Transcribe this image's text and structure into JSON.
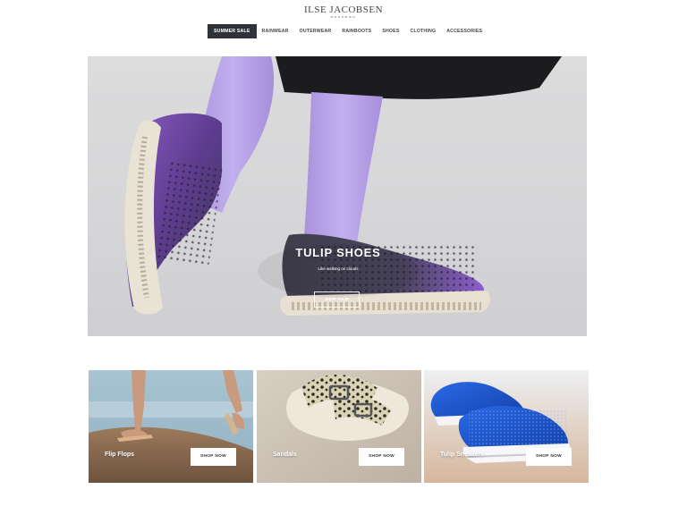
{
  "header": {
    "logo": "ILSE JACOBSEN",
    "logo_sub": "HORNBÆK"
  },
  "nav": {
    "items": [
      {
        "label": "SUMMER SALE",
        "active": true
      },
      {
        "label": "RAINWEAR"
      },
      {
        "label": "OUTERWEAR"
      },
      {
        "label": "RAINBOOTS"
      },
      {
        "label": "SHOES"
      },
      {
        "label": "CLOTHING"
      },
      {
        "label": "ACCESSORIES"
      }
    ]
  },
  "hero": {
    "title": "TULIP SHOES",
    "subtitle": "Like walking on clouds",
    "button": "SHOP TULIP"
  },
  "tiles": [
    {
      "label": "Flip Flops",
      "button": "SHOP NOW"
    },
    {
      "label": "Sandals",
      "button": "SHOP NOW"
    },
    {
      "label": "Tulip Sneakers",
      "button": "SHOP NOW"
    }
  ],
  "colors": {
    "nav_active_bg": "#2f3338",
    "hero_bg": "#d6d6d8",
    "shoe_purple": "#7a4fb0",
    "sock_lavender": "#b7a2e6",
    "sneaker_blue": "#1f5fd8"
  }
}
